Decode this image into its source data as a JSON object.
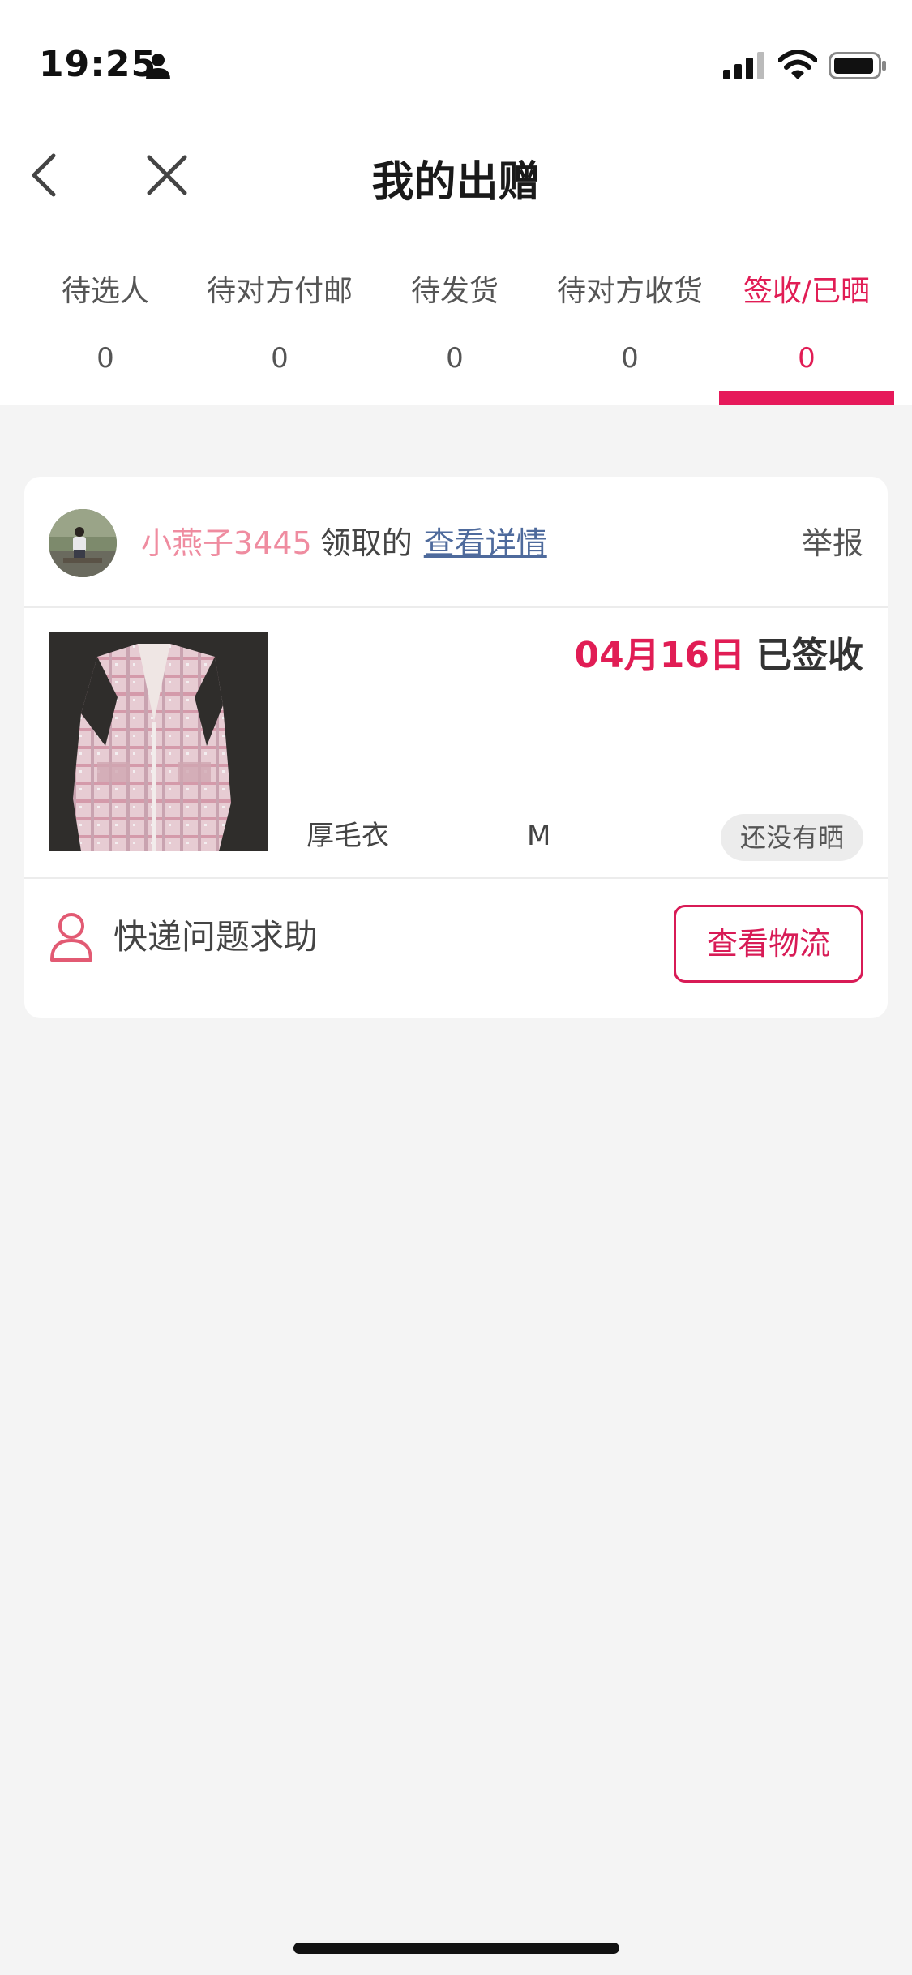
{
  "status_bar": {
    "time": "19:25"
  },
  "nav": {
    "title": "我的出赠"
  },
  "tabs": [
    {
      "label": "待选人",
      "count": "0"
    },
    {
      "label": "待对方付邮",
      "count": "0"
    },
    {
      "label": "待发货",
      "count": "0"
    },
    {
      "label": "待对方收货",
      "count": "0"
    },
    {
      "label": "签收/已晒",
      "count": "0",
      "active": true
    }
  ],
  "card": {
    "username": "小燕子3445",
    "claimed_text": "领取的",
    "detail_link": "查看详情",
    "report": "举报",
    "date": "04月16日",
    "date_status": "已签收",
    "item_name": "厚毛衣",
    "item_size": "M",
    "share_status": "还没有晒",
    "help_text": "快递问题求助",
    "logistics_button": "查看物流"
  },
  "colors": {
    "accent": "#e6195a",
    "username": "#ef8ca0",
    "link": "#4e6a9c",
    "background": "#f4f4f4"
  }
}
